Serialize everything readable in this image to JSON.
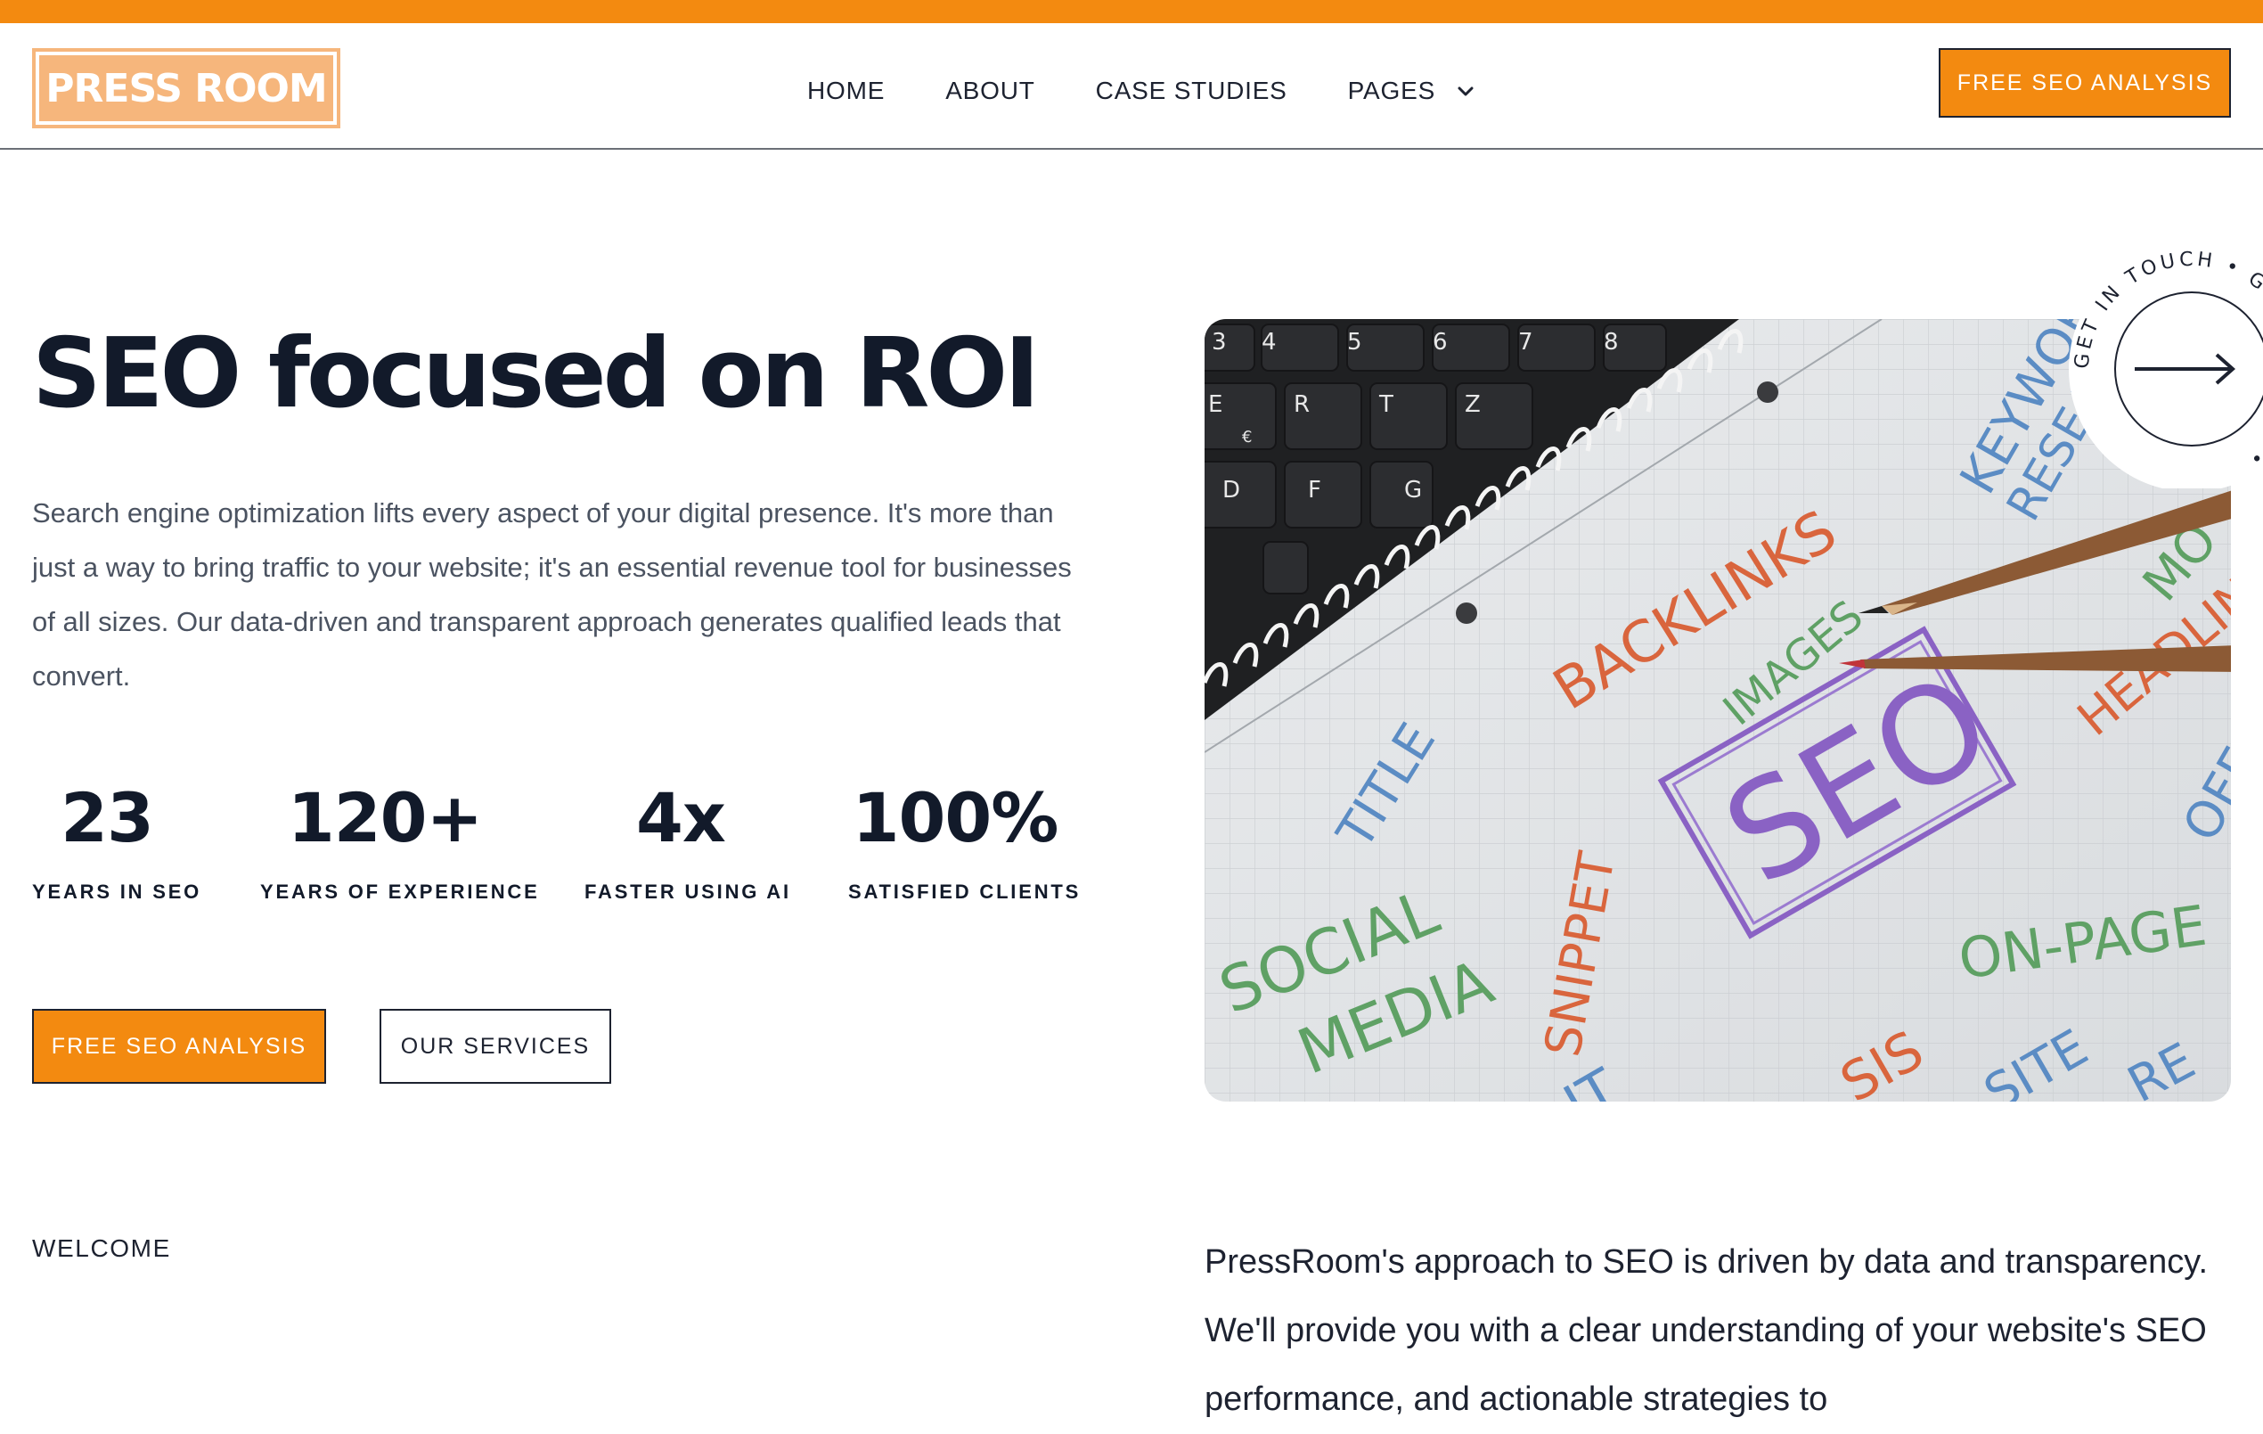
{
  "brand": {
    "logo_text": "PRESS ROOM",
    "accent_color": "#f38a10",
    "text_color": "#121a2a"
  },
  "nav": {
    "items": [
      {
        "label": "HOME"
      },
      {
        "label": "ABOUT"
      },
      {
        "label": "CASE STUDIES"
      }
    ],
    "pages_label": "PAGES",
    "pages_icon": "chevron-down-icon"
  },
  "header": {
    "cta_label": "FREE SEO ANALYSIS"
  },
  "hero": {
    "title_prefix": "SEO focused on ",
    "title_highlight": "ROI",
    "description": "Search engine optimization lifts every aspect of your digital presence. It's more than just a way to bring traffic to your website; it's an essential revenue tool for businesses of all sizes. Our data-driven and transparent approach generates qualified leads that convert.",
    "stats": [
      {
        "value": "23",
        "label": "YEARS IN SEO"
      },
      {
        "value": "120+",
        "label": "YEARS OF EXPERIENCE"
      },
      {
        "value": "4x",
        "label": "FASTER USING AI"
      },
      {
        "value": "100%",
        "label": "SATISFIED CLIENTS"
      }
    ],
    "primary_button": "FREE SEO ANALYSIS",
    "secondary_button": "OUR SERVICES"
  },
  "image": {
    "keyboard_keys": [
      "4",
      "5",
      "6",
      "7",
      "8",
      "R",
      "T",
      "Z",
      "E",
      "D",
      "F",
      "G",
      "€"
    ],
    "words": [
      {
        "text": "BACKLINKS",
        "color": "#d9653d"
      },
      {
        "text": "IMAGES",
        "color": "#5fa165"
      },
      {
        "text": "KEYWORD",
        "color": "#5b8cc4"
      },
      {
        "text": "RESEARCH",
        "color": "#5b8cc4"
      },
      {
        "text": "MO",
        "color": "#5fa165"
      },
      {
        "text": "HEADLINE",
        "color": "#d9653d"
      },
      {
        "text": "TITLE",
        "color": "#5b8cc4"
      },
      {
        "text": "SEO",
        "color": "#8a62c4"
      },
      {
        "text": "OFF",
        "color": "#5b8cc4"
      },
      {
        "text": "SOCIAL",
        "color": "#5fa165"
      },
      {
        "text": "MEDIA",
        "color": "#5fa165"
      },
      {
        "text": "SNIPPET",
        "color": "#d9653d"
      },
      {
        "text": "ON-PAGE",
        "color": "#5fa165"
      },
      {
        "text": "SIS",
        "color": "#d9653d"
      },
      {
        "text": "SITE",
        "color": "#5b8cc4"
      },
      {
        "text": "RE",
        "color": "#5b8cc4"
      },
      {
        "text": "IT",
        "color": "#5b8cc4"
      }
    ]
  },
  "badge": {
    "text": "GET IN TOUCH • GET IN TOUCH • ",
    "icon": "arrow-right-icon"
  },
  "welcome": {
    "label": "WELCOME",
    "text": "PressRoom's approach to SEO is driven by data and transparency. We'll provide you with a clear understanding of your website's SEO performance, and actionable strategies to"
  }
}
